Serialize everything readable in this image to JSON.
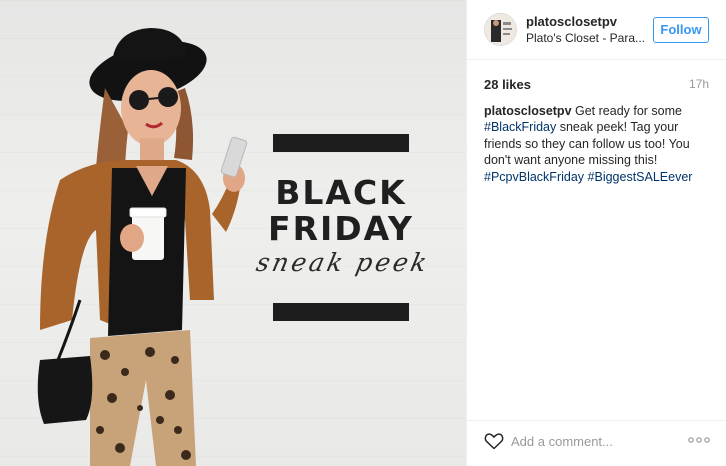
{
  "post": {
    "image": {
      "promo_line_1": "BLACK",
      "promo_line_2": "FRIDAY",
      "promo_script": "sneak peek"
    }
  },
  "header": {
    "username": "platosclosetpv",
    "location": "Plato's Closet - Para...",
    "follow_label": "Follow"
  },
  "stats": {
    "likes": "28 likes",
    "age": "17h"
  },
  "caption": {
    "username": "platosclosetpv",
    "text_1": " Get ready for some ",
    "tag_1": "#BlackFriday",
    "text_2": " sneak peek! Tag your friends so they can follow us too! You don't want anyone missing this! ",
    "tag_2": "#PcpvBlackFriday",
    "text_3": " ",
    "tag_3": "#BiggestSALEever"
  },
  "footer": {
    "comment_placeholder": "Add a comment...",
    "like_icon": "heart-icon",
    "more_icon": "more-options-icon"
  },
  "colors": {
    "link": "#003569",
    "follow": "#3897f0",
    "muted": "#999999"
  }
}
